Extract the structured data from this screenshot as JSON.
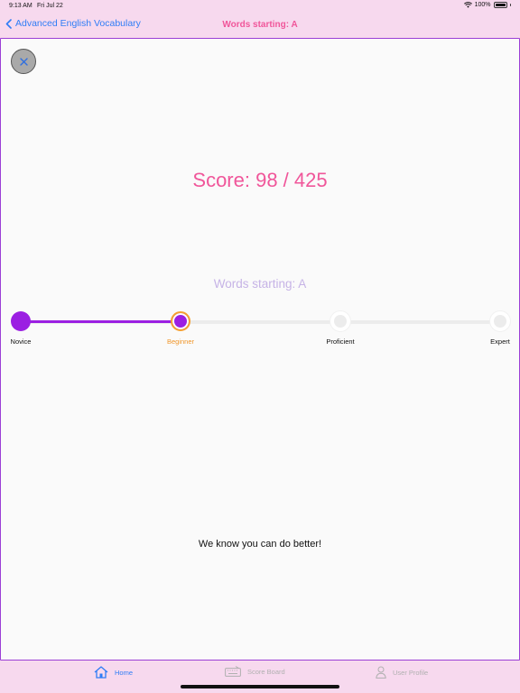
{
  "status": {
    "time": "9:13 AM",
    "date": "Fri Jul 22",
    "battery": "100%"
  },
  "nav": {
    "back_label": "Advanced English Vocabulary",
    "title": "Words starting: A"
  },
  "result": {
    "score_text": "Score: 98 / 425",
    "subtitle": "Words starting: A",
    "message": "We know you can do better!"
  },
  "levels": {
    "current_index": 1,
    "items": [
      {
        "label": "Novice",
        "state": "done"
      },
      {
        "label": "Beginner",
        "state": "current"
      },
      {
        "label": "Proficient",
        "state": "todo"
      },
      {
        "label": "Expert",
        "state": "todo"
      }
    ]
  },
  "tabs": [
    {
      "label": "Home",
      "icon": "home-icon",
      "active": true
    },
    {
      "label": "Score Board",
      "icon": "keyboard-icon",
      "active": false
    },
    {
      "label": "User Profile",
      "icon": "person-icon",
      "active": false
    }
  ],
  "colors": {
    "accent_pink": "#f0569a",
    "link_blue": "#2f7df6",
    "progress_purple": "#9b1fe2",
    "current_orange": "#f5a030",
    "background": "#f7d9ee"
  }
}
